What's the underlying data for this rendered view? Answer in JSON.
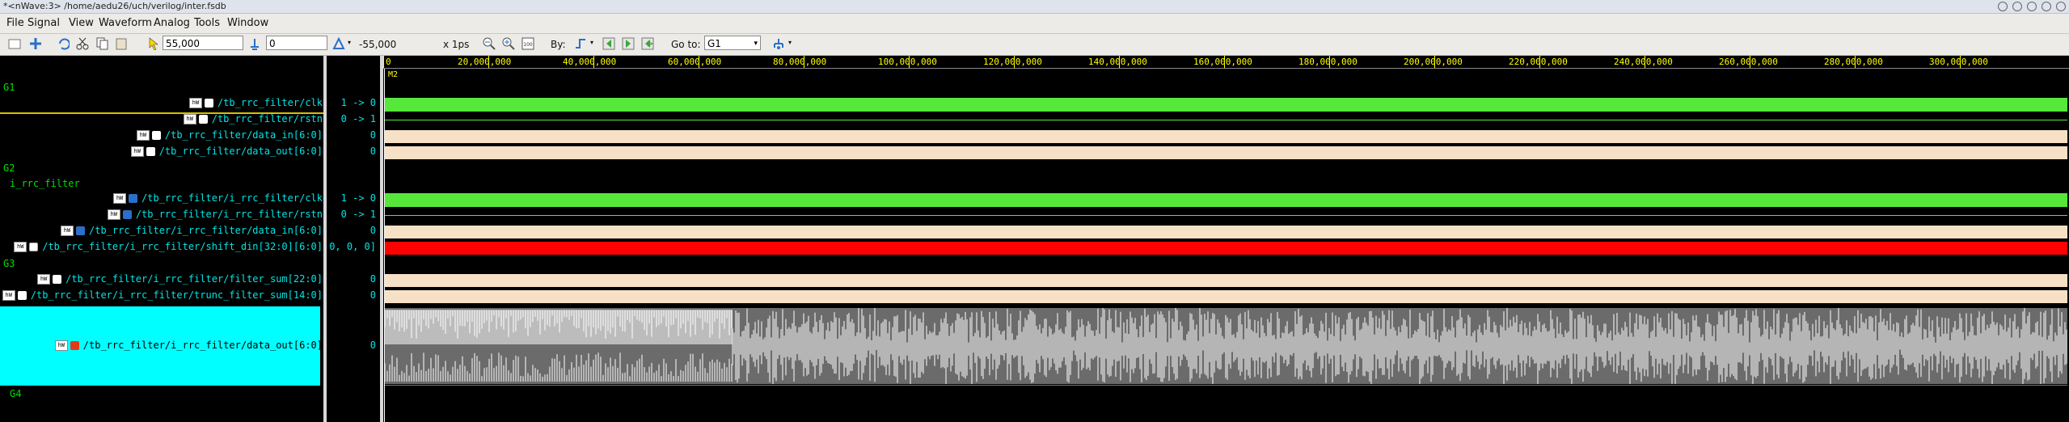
{
  "window": {
    "title": "*<nWave:3> /home/aedu26/uch/verilog/inter.fsdb"
  },
  "menu": [
    "File",
    "Signal",
    "View",
    "Waveform",
    "Analog",
    "Tools",
    "Window"
  ],
  "toolbar": {
    "cursor_time": "55,000",
    "marker_time": "0",
    "delta": "-55,000",
    "time_unit": "x 1ps",
    "by_label": "By:",
    "goto_label": "Go to:",
    "goto_value": "G1"
  },
  "ruler": {
    "ticks": [
      "0",
      "20,000,000",
      "40,000,000",
      "60,000,000",
      "80,000,000",
      "100,000,000",
      "120,000,000",
      "140,000,000",
      "160,000,000",
      "180,000,000",
      "200,000,000",
      "220,000,000",
      "240,000,000",
      "260,000,000",
      "280,000,000",
      "300,000,000"
    ],
    "marker": "M2"
  },
  "groups": [
    {
      "label": "G1"
    },
    {
      "label": "G2"
    },
    {
      "label": "G3"
    },
    {
      "label": "G4"
    }
  ],
  "subgroup": "i_rrc_filter",
  "signals": [
    {
      "name": "/tb_rrc_filter/clk",
      "value": "1 -> 0",
      "wave": "green"
    },
    {
      "name": "/tb_rrc_filter/rstn",
      "value": "0 -> 1",
      "wave": "flat"
    },
    {
      "name": "/tb_rrc_filter/data_in[6:0]",
      "value": "0",
      "wave": "bus"
    },
    {
      "name": "/tb_rrc_filter/data_out[6:0]",
      "value": "0",
      "wave": "bus"
    },
    {
      "name": "/tb_rrc_filter/i_rrc_filter/clk",
      "value": "1 -> 0",
      "wave": "green"
    },
    {
      "name": "/tb_rrc_filter/i_rrc_filter/rstn",
      "value": "0 -> 1",
      "wave": "flat"
    },
    {
      "name": "/tb_rrc_filter/i_rrc_filter/data_in[6:0]",
      "value": "0",
      "wave": "bus"
    },
    {
      "name": "/tb_rrc_filter/i_rrc_filter/shift_din[32:0][6:0]",
      "value": "0, 0, 0]",
      "wave": "red"
    },
    {
      "name": "/tb_rrc_filter/i_rrc_filter/filter_sum[22:0]",
      "value": "0",
      "wave": "bus"
    },
    {
      "name": "/tb_rrc_filter/i_rrc_filter/trunc_filter_sum[14:0]",
      "value": "0",
      "wave": "bus"
    },
    {
      "name": "/tb_rrc_filter/i_rrc_filter/data_out[6:0]",
      "value": "0",
      "wave": "analog"
    }
  ],
  "colors": {
    "green": "#55e83a",
    "bus": "#f7e1c6",
    "red": "#ff0000",
    "cyan": "#00ffff",
    "analog_bg": "#6b6b6b"
  }
}
